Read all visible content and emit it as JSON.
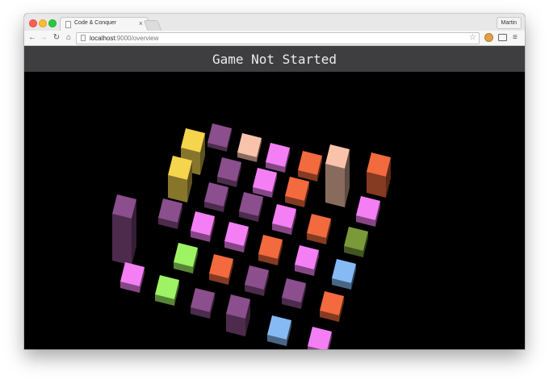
{
  "browser": {
    "tab_title": "Code & Conquer",
    "tab_close": "×",
    "user_name": "Martin",
    "url_host": "localhost",
    "url_path": ":9000/overview"
  },
  "game": {
    "status": "Game Not Started"
  },
  "colors": {
    "purple": "#8a4f8c",
    "pink": "#f47ff4",
    "orange": "#f26a3e",
    "peach": "#f9c3ab",
    "yellow": "#f5d44e",
    "green": "#9ef364",
    "olive": "#7a9a3a",
    "blue": "#86baf4"
  }
}
